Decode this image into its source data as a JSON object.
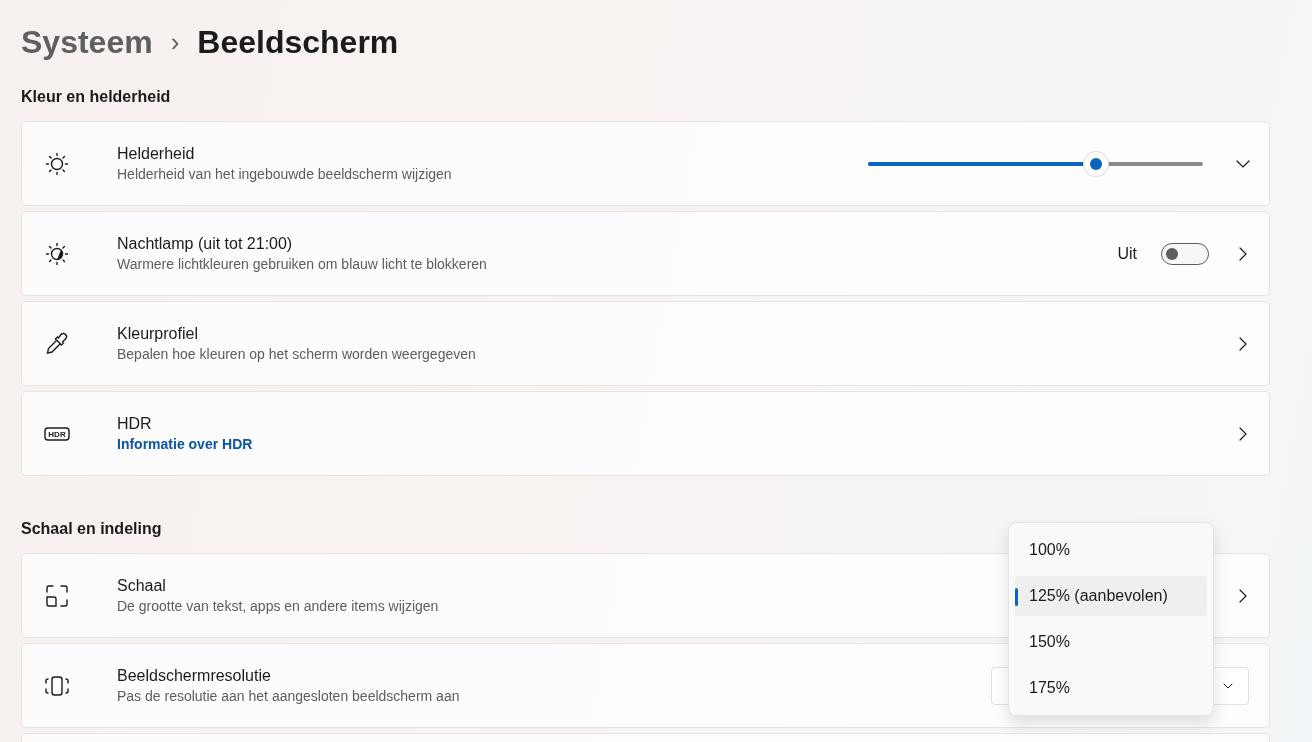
{
  "breadcrumb": {
    "parent": "Systeem",
    "separator": "›",
    "current": "Beeldscherm"
  },
  "sections": [
    {
      "title": "Kleur en helderheid",
      "rows": [
        {
          "title": "Helderheid",
          "description": "Helderheid van het ingebouwde beeldscherm wijzigen",
          "control": {
            "kind": "slider",
            "level": 0.68
          }
        },
        {
          "title": "Nachtlamp (uit tot 21:00)",
          "description": "Warmere lichtkleuren gebruiken om blauw licht te blokkeren",
          "control": {
            "kind": "toggle",
            "on": false,
            "label": "Uit"
          }
        },
        {
          "title": "Kleurprofiel",
          "description": "Bepalen hoe kleuren op het scherm worden weergegeven"
        },
        {
          "icon_label": "HDR",
          "title": "HDR",
          "link": "Informatie over HDR"
        }
      ]
    },
    {
      "title": "Schaal en indeling",
      "rows": [
        {
          "title": "Schaal",
          "description": "De grootte van tekst, apps en andere items wijzigen",
          "popup": {
            "options": [
              {
                "label": "100%",
                "selected": false
              },
              {
                "label": "125% (aanbevolen)",
                "selected": true
              },
              {
                "label": "150%",
                "selected": false
              },
              {
                "label": "175%",
                "selected": false
              }
            ]
          }
        },
        {
          "title": "Beeldschermresolutie",
          "description": "Pas de resolutie aan het aangesloten beeldscherm aan",
          "control": {
            "kind": "combo"
          }
        }
      ]
    }
  ]
}
